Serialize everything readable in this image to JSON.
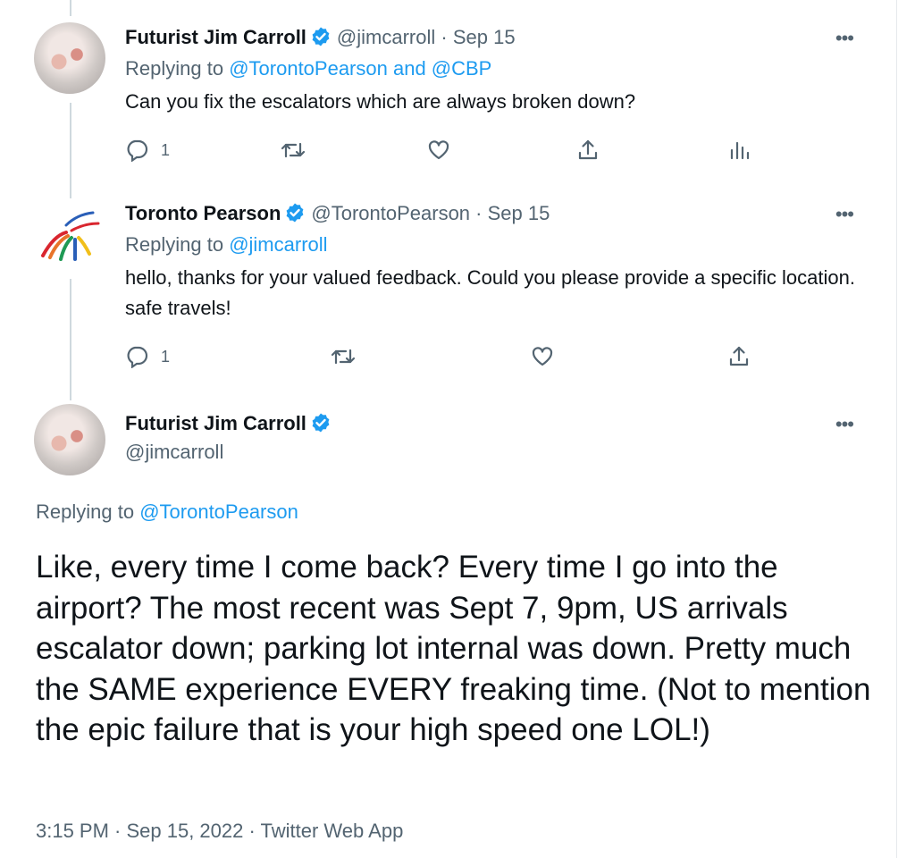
{
  "tweets": [
    {
      "name": "Futurist Jim Carroll",
      "handle": "@jimcarroll",
      "date": "Sep 15",
      "replying_prefix": "Replying to",
      "replying_handles": "@TorontoPearson and @CBP",
      "text": "Can you fix the escalators which are always broken down?",
      "reply_count": "1"
    },
    {
      "name": "Toronto Pearson",
      "handle": "@TorontoPearson",
      "date": "Sep 15",
      "replying_prefix": "Replying to",
      "replying_handles": "@jimcarroll",
      "text": "hello, thanks for your valued feedback. Could you please provide a specific location. safe travels!",
      "reply_count": "1"
    },
    {
      "name": "Futurist Jim Carroll",
      "handle": "@jimcarroll",
      "replying_prefix": "Replying to",
      "replying_handles": "@TorontoPearson",
      "text": "Like, every time I come back? Every time I go into the airport? The most recent was Sept 7, 9pm, US arrivals escalator down; parking lot internal was down. Pretty much the SAME experience EVERY freaking time. (Not to mention the epic failure that is your high speed one LOL!)",
      "timestamp": "3:15 PM · Sep 15, 2022 · Twitter Web App"
    }
  ],
  "separator": "·",
  "more_label": "•••",
  "icons": [
    "verified-badge-icon",
    "reply-icon",
    "retweet-icon",
    "like-icon",
    "share-icon",
    "analytics-icon",
    "more-icon"
  ],
  "colors": {
    "link": "#1d9bf0",
    "secondary": "#536471",
    "text": "#0f1419",
    "verified": "#1d9bf0"
  }
}
